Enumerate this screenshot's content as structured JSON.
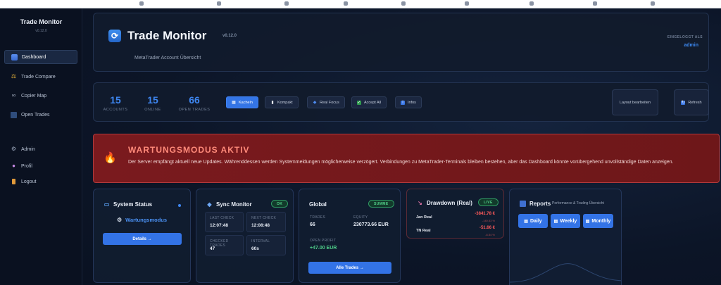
{
  "sidebar": {
    "brand": "Trade Monitor",
    "version": "v0.12.0",
    "items": [
      {
        "label": "Dashboard",
        "icon": "chart-icon"
      },
      {
        "label": "Trade Compare",
        "icon": "scale-icon"
      },
      {
        "label": "Copier Map",
        "icon": "link-icon"
      },
      {
        "label": "Open Trades",
        "icon": "trend-icon"
      },
      {
        "label": "Admin",
        "icon": "gear-icon"
      },
      {
        "label": "Profil",
        "icon": "user-icon"
      },
      {
        "label": "Logout",
        "icon": "door-icon"
      }
    ]
  },
  "header": {
    "title": "Trade Monitor",
    "version": "v0.12.0",
    "subtitle": "MetaTrader Account Übersicht",
    "login_label": "EINGELOGGT ALS",
    "login_user": "admin"
  },
  "stats": [
    {
      "value": "15",
      "label": "ACCOUNTS"
    },
    {
      "value": "15",
      "label": "ONLINE"
    },
    {
      "value": "66",
      "label": "OPEN TRADES"
    }
  ],
  "view_buttons": [
    {
      "label": "Kacheln",
      "active": true
    },
    {
      "label": "Kompakt",
      "active": false
    },
    {
      "label": "Real Focus",
      "active": false
    },
    {
      "label": "Accept All",
      "active": false
    },
    {
      "label": "Infos",
      "active": false
    }
  ],
  "right_buttons": {
    "layout": "Layout bearbeiten",
    "refresh": "Refresh"
  },
  "alert": {
    "title": "WARTUNGSMODUS AKTIV",
    "text": "Der Server empfängt aktuell neue Updates. Währenddessen werden Systemmeldungen möglicherweise verzögert. Verbindungen zu MetaTrader-Terminals bleiben bestehen, aber das Dashboard könnte vorübergehend unvollständige Daten anzeigen."
  },
  "system_status": {
    "title": "System Status",
    "status": "Wartungsmodus",
    "button": "Details →"
  },
  "sync_monitor": {
    "title": "Sync Monitor",
    "badge": "OK",
    "cells": [
      {
        "label": "LAST CHECK",
        "value": "12:07:48"
      },
      {
        "label": "NEXT CHECK",
        "value": "12:08:48"
      },
      {
        "label": "CHECKED TRADES",
        "value": "47"
      },
      {
        "label": "INTERVAL",
        "value": "60s"
      }
    ]
  },
  "global": {
    "title": "Global",
    "badge": "SUMME",
    "trades_label": "TRADES",
    "trades_value": "66",
    "equity_label": "EQUITY",
    "equity_value": "230773.66 EUR",
    "profit_label": "OPEN PROFIT",
    "profit_value": "+47.00 EUR",
    "button": "Alle Trades →"
  },
  "drawdown": {
    "title": "Drawdown (Real)",
    "badge": "LIVE",
    "rows": [
      {
        "name": "Jan Real",
        "value": "-3841.78 €",
        "sub": "-140.53 %"
      },
      {
        "name": "TN Real",
        "value": "-51.66 €",
        "sub": "-6.54 %"
      }
    ]
  },
  "reports": {
    "title": "Reports",
    "subtitle": "Performance & Trading Übersicht",
    "buttons": [
      "Daily",
      "Weekly",
      "Monthly"
    ]
  },
  "colors": {
    "accent": "#3475e6",
    "alert_bg": "#7a1a1e",
    "ok": "#53d28b",
    "loss": "#ff5a5a"
  }
}
